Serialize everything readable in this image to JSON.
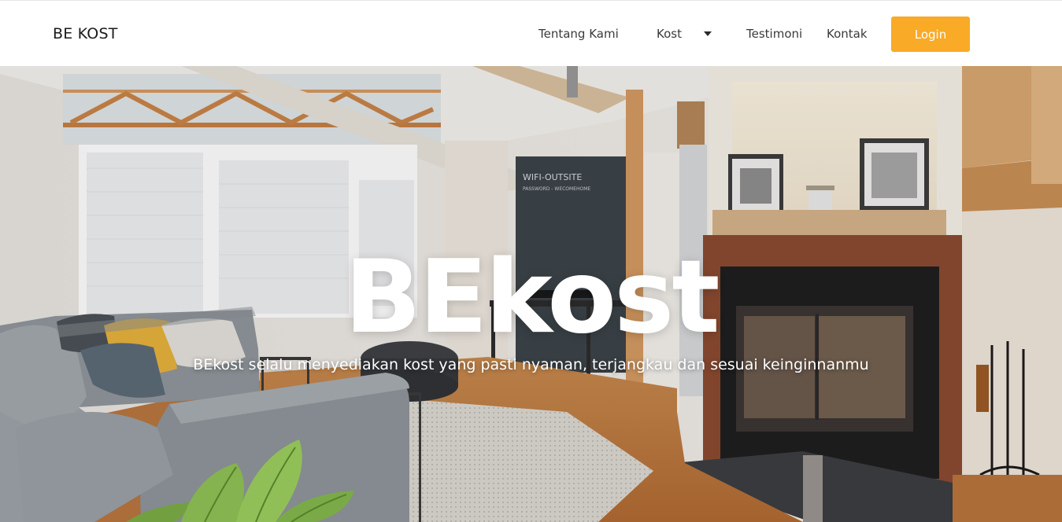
{
  "navbar": {
    "brand": "BE KOST",
    "links": {
      "tentang_kami": "Tentang Kami",
      "kost": "Kost",
      "testimoni": "Testimoni",
      "kontak": "Kontak"
    },
    "login_label": "Login"
  },
  "hero": {
    "title": "BEkost",
    "subtitle": "BEkost selalu menyediakan kost yang pasti nyaman, terjangkau dan sesuai keinginnanmu",
    "chalkboard_text": {
      "line1": "WIFI-OUTSITE",
      "line2": "PASSWORD - WECOMEHOME"
    }
  },
  "colors": {
    "accent": "#f9aa26",
    "navbar_bg": "#ffffff",
    "brand_text": "#1b1b1b",
    "nav_text": "#3a3a3a"
  },
  "icons": {
    "kost_dropdown": "chevron-down-icon"
  }
}
